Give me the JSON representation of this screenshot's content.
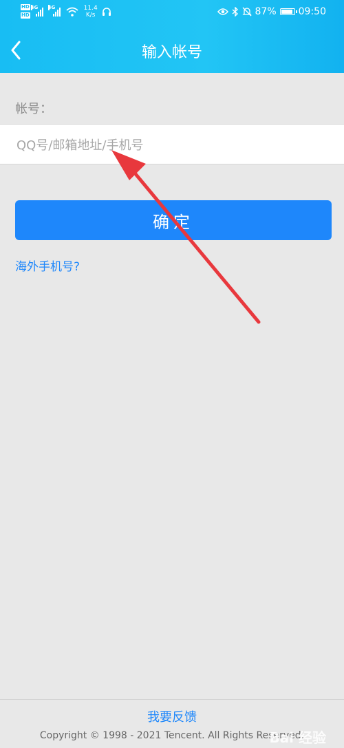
{
  "status_bar": {
    "hd1": "HD",
    "hd2": "HD",
    "net1": "4G",
    "net2": "4G",
    "speed_value": "11.4",
    "speed_unit": "K/s",
    "battery": "87%",
    "time": "09:50",
    "icons": [
      "eye-icon",
      "bluetooth-icon",
      "mute-icon",
      "battery-icon",
      "wifi-icon",
      "headset-icon"
    ]
  },
  "header": {
    "title": "输入帐号",
    "back_icon": "chevron-left-icon"
  },
  "form": {
    "account_label": "帐号：",
    "account_placeholder": "QQ号/邮箱地址/手机号",
    "account_value": "",
    "confirm_label": "确定",
    "overseas_link": "海外手机号?"
  },
  "footer": {
    "feedback": "我要反馈",
    "copyright": "Copyright © 1998 - 2021 Tencent. All Rights Reserved.",
    "watermark": "Bai 经验"
  },
  "colors": {
    "header": "#1ebcf3",
    "primary": "#1e87fb",
    "background": "#e8e8e8",
    "annotation_arrow": "#e8383d"
  }
}
